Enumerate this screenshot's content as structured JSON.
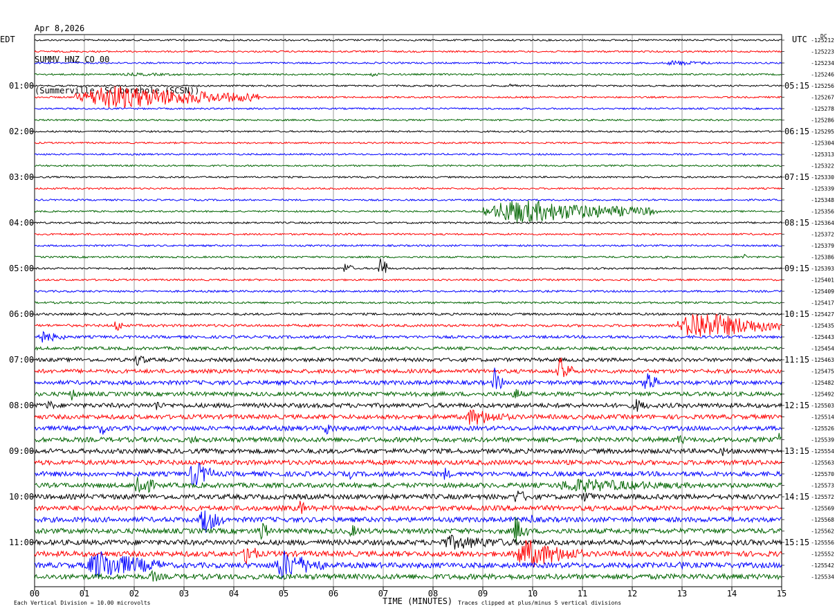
{
  "header": {
    "date": "Apr 8,2026",
    "station": "SUMMV HNZ CO 00",
    "location": "(Summerville, SC borehole (SCSN))"
  },
  "left_tz": "EDT",
  "right_tz": "UTC",
  "dc_label": "DC",
  "x_title": "TIME (MINUTES)",
  "scale_note": "Each Vertical Division = 10.00 microvolts",
  "clip_note": "Traces clipped at plus/minus 5 vertical divisions",
  "colors": {
    "black": "#000000",
    "red": "#ff0000",
    "blue": "#0000ff",
    "green": "#006400",
    "grid": "#000000"
  },
  "chart_data": {
    "type": "line",
    "title": "SUMMV HNZ CO 00",
    "xlabel": "TIME (MINUTES)",
    "x_ticks": [
      "00",
      "01",
      "02",
      "03",
      "04",
      "05",
      "06",
      "07",
      "08",
      "09",
      "10",
      "11",
      "12",
      "13",
      "14",
      "15"
    ],
    "xlim": [
      0,
      15
    ],
    "trace_minutes": 15,
    "trace_colors": [
      "black",
      "red",
      "blue",
      "green"
    ],
    "left_hour_labels": [
      {
        "trace": 4,
        "label": "01:00"
      },
      {
        "trace": 8,
        "label": "02:00"
      },
      {
        "trace": 12,
        "label": "03:00"
      },
      {
        "trace": 16,
        "label": "04:00"
      },
      {
        "trace": 20,
        "label": "05:00"
      },
      {
        "trace": 24,
        "label": "06:00"
      },
      {
        "trace": 28,
        "label": "07:00"
      },
      {
        "trace": 32,
        "label": "08:00"
      },
      {
        "trace": 36,
        "label": "09:00"
      },
      {
        "trace": 40,
        "label": "10:00"
      },
      {
        "trace": 44,
        "label": "11:00"
      }
    ],
    "right_hour_labels": [
      {
        "trace": 4,
        "label": "05:15"
      },
      {
        "trace": 8,
        "label": "06:15"
      },
      {
        "trace": 12,
        "label": "07:15"
      },
      {
        "trace": 16,
        "label": "08:15"
      },
      {
        "trace": 20,
        "label": "09:15"
      },
      {
        "trace": 24,
        "label": "10:15"
      },
      {
        "trace": 28,
        "label": "11:15"
      },
      {
        "trace": 32,
        "label": "12:15"
      },
      {
        "trace": 36,
        "label": "13:15"
      },
      {
        "trace": 40,
        "label": "14:15"
      },
      {
        "trace": 44,
        "label": "15:15"
      }
    ],
    "dc_offsets": [
      "-125212",
      "-125223",
      "-125234",
      "-125246",
      "-125256",
      "-125267",
      "-125278",
      "-125286",
      "-125295",
      "-125304",
      "-125313",
      "-125322",
      "-125330",
      "-125339",
      "-125348",
      "-125356",
      "-125364",
      "-125372",
      "-125379",
      "-125386",
      "-125393",
      "-125401",
      "-125409",
      "-125417",
      "-125427",
      "-125435",
      "-125443",
      "-125454",
      "-125463",
      "-125475",
      "-125482",
      "-125492",
      "-125503",
      "-125514",
      "-125526",
      "-125539",
      "-125554",
      "-125563",
      "-125570",
      "-125573",
      "-125572",
      "-125569",
      "-125568",
      "-125562",
      "-125556",
      "-125552",
      "-125542",
      "-125534"
    ],
    "noise_levels": [
      1.2,
      1.2,
      1.2,
      1.2,
      1.2,
      1.2,
      1.2,
      1.2,
      1.2,
      1.2,
      1.2,
      1.2,
      1.2,
      1.2,
      1.2,
      1.2,
      1.3,
      1.3,
      1.3,
      1.3,
      1.3,
      1.3,
      1.4,
      1.4,
      1.6,
      1.8,
      2.0,
      2.2,
      2.6,
      2.8,
      3.0,
      3.0,
      3.2,
      3.2,
      3.2,
      3.4,
      3.4,
      3.4,
      3.4,
      3.4,
      3.6,
      3.6,
      3.6,
      3.6,
      3.8,
      3.8,
      3.8,
      3.8
    ],
    "events": [
      {
        "trace": 3,
        "start": 1.5,
        "end": 4.4,
        "amp": 3
      },
      {
        "trace": 3,
        "start": 6.7,
        "end": 7.0,
        "amp": 5
      },
      {
        "trace": 2,
        "start": 12.6,
        "end": 13.9,
        "amp": 5
      },
      {
        "trace": 4,
        "start": 9.4,
        "end": 9.9,
        "amp": 4
      },
      {
        "trace": 5,
        "start": 0.8,
        "end": 4.5,
        "amp": 24
      },
      {
        "trace": 15,
        "start": 9.0,
        "end": 12.5,
        "amp": 24
      },
      {
        "trace": 20,
        "start": 6.2,
        "end": 6.4,
        "amp": 14
      },
      {
        "trace": 20,
        "start": 6.9,
        "end": 7.1,
        "amp": 30
      },
      {
        "trace": 19,
        "start": 14.2,
        "end": 14.3,
        "amp": 12
      },
      {
        "trace": 25,
        "start": 1.6,
        "end": 1.8,
        "amp": 16
      },
      {
        "trace": 25,
        "start": 12.9,
        "end": 15.0,
        "amp": 30
      },
      {
        "trace": 26,
        "start": 0.0,
        "end": 0.6,
        "amp": 14
      },
      {
        "trace": 28,
        "start": 2.0,
        "end": 2.3,
        "amp": 14
      },
      {
        "trace": 29,
        "start": 10.5,
        "end": 10.8,
        "amp": 30
      },
      {
        "trace": 30,
        "start": 9.2,
        "end": 9.4,
        "amp": 30
      },
      {
        "trace": 30,
        "start": 12.2,
        "end": 12.5,
        "amp": 30
      },
      {
        "trace": 31,
        "start": 0.7,
        "end": 0.9,
        "amp": 14
      },
      {
        "trace": 31,
        "start": 7.5,
        "end": 7.7,
        "amp": 14
      },
      {
        "trace": 31,
        "start": 9.6,
        "end": 9.8,
        "amp": 18
      },
      {
        "trace": 32,
        "start": 0.2,
        "end": 0.5,
        "amp": 12
      },
      {
        "trace": 32,
        "start": 2.4,
        "end": 2.6,
        "amp": 14
      },
      {
        "trace": 32,
        "start": 12.0,
        "end": 12.4,
        "amp": 14
      },
      {
        "trace": 33,
        "start": 8.6,
        "end": 9.6,
        "amp": 18
      },
      {
        "trace": 34,
        "start": 1.3,
        "end": 1.5,
        "amp": 16
      },
      {
        "trace": 34,
        "start": 5.8,
        "end": 6.1,
        "amp": 14
      },
      {
        "trace": 35,
        "start": 3.1,
        "end": 3.3,
        "amp": 12
      },
      {
        "trace": 35,
        "start": 12.9,
        "end": 13.1,
        "amp": 14
      },
      {
        "trace": 35,
        "start": 14.9,
        "end": 15.0,
        "amp": 22
      },
      {
        "trace": 36,
        "start": 13.8,
        "end": 13.9,
        "amp": 14
      },
      {
        "trace": 38,
        "start": 3.1,
        "end": 3.6,
        "amp": 30
      },
      {
        "trace": 38,
        "start": 6.3,
        "end": 6.4,
        "amp": 14
      },
      {
        "trace": 38,
        "start": 8.2,
        "end": 8.4,
        "amp": 14
      },
      {
        "trace": 39,
        "start": 2.0,
        "end": 2.4,
        "amp": 30
      },
      {
        "trace": 39,
        "start": 10.3,
        "end": 13.6,
        "amp": 14
      },
      {
        "trace": 40,
        "start": 9.6,
        "end": 10.0,
        "amp": 16
      },
      {
        "trace": 40,
        "start": 11.0,
        "end": 11.3,
        "amp": 14
      },
      {
        "trace": 41,
        "start": 5.3,
        "end": 5.5,
        "amp": 18
      },
      {
        "trace": 42,
        "start": 3.3,
        "end": 3.8,
        "amp": 30
      },
      {
        "trace": 42,
        "start": 9.9,
        "end": 10.1,
        "amp": 14
      },
      {
        "trace": 43,
        "start": 4.5,
        "end": 4.7,
        "amp": 30
      },
      {
        "trace": 43,
        "start": 9.6,
        "end": 9.9,
        "amp": 30
      },
      {
        "trace": 43,
        "start": 6.3,
        "end": 6.6,
        "amp": 14
      },
      {
        "trace": 44,
        "start": 8.0,
        "end": 10.2,
        "amp": 14
      },
      {
        "trace": 45,
        "start": 4.2,
        "end": 4.5,
        "amp": 30
      },
      {
        "trace": 45,
        "start": 9.6,
        "end": 11.0,
        "amp": 30
      },
      {
        "trace": 46,
        "start": 1.0,
        "end": 2.6,
        "amp": 30
      },
      {
        "trace": 46,
        "start": 4.8,
        "end": 5.8,
        "amp": 30
      },
      {
        "trace": 46,
        "start": 12.9,
        "end": 13.1,
        "amp": 14
      },
      {
        "trace": 47,
        "start": 2.3,
        "end": 2.6,
        "amp": 14
      }
    ]
  }
}
